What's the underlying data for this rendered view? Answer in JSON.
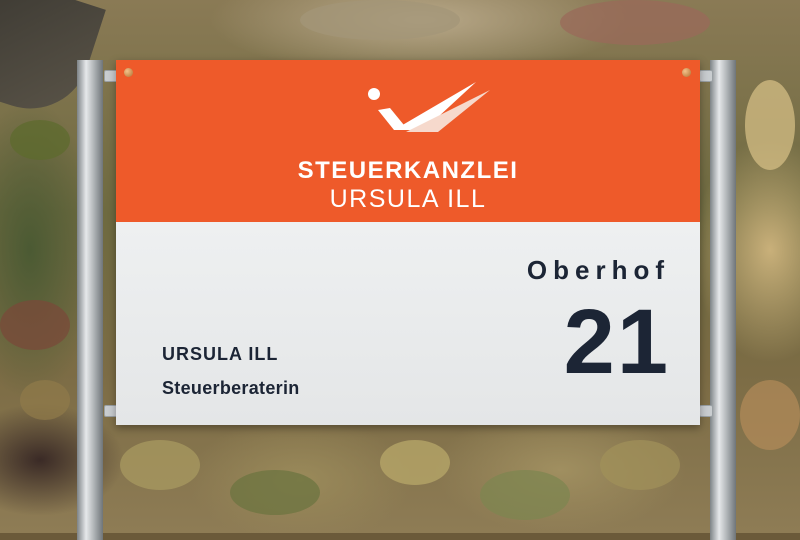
{
  "sign": {
    "firm_line1": "STEUERKANZLEI",
    "firm_line2": "URSULA ILL",
    "street": "Oberhof",
    "house_number": "21",
    "person_name": "URSULA ILL",
    "person_title": "Steuerberaterin"
  },
  "colors": {
    "brand_orange": "#ee5a2a",
    "panel_white": "#eef0f1",
    "text_navy": "#1c2535"
  },
  "icons": {
    "logo": "checkmark-logo-icon"
  }
}
